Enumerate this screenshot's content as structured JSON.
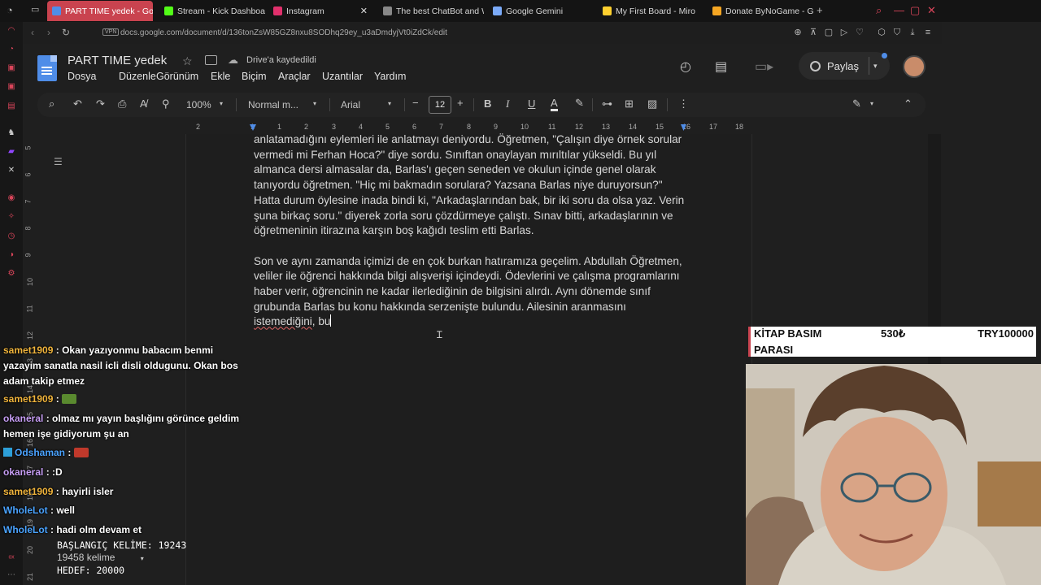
{
  "browser": {
    "tabs": [
      {
        "label": "PART TIME yedek - Goog",
        "active": true,
        "color": "#4f8de8"
      },
      {
        "label": "Stream - Kick Dashboard",
        "active": false,
        "color": "#53fc18"
      },
      {
        "label": "Instagram",
        "active": false,
        "color": "#e1306c"
      },
      {
        "label": "The best ChatBot and W",
        "active": false,
        "color": "#888888"
      },
      {
        "label": "Google Gemini",
        "active": false,
        "color": "#7baaf7"
      },
      {
        "label": "My First Board - Miro",
        "active": false,
        "color": "#ffd02f"
      },
      {
        "label": "Donate ByNoGame - Gel",
        "active": false,
        "color": "#f5a623"
      }
    ],
    "vpn": "VPN",
    "url": "docs.google.com/document/d/136tonZsW85GZ8nxu8SODhq29ey_u3aDmdyjVt0iZdCk/edit"
  },
  "docs": {
    "title": "PART TIME  yedek",
    "saved": "Drive'a kaydedildi",
    "menu": [
      "Dosya",
      "Düzenle",
      "Görünüm",
      "Ekle",
      "Biçim",
      "Araçlar",
      "Uzantılar",
      "Yardım"
    ],
    "share": "Paylaş",
    "toolbar": {
      "zoom": "100%",
      "style": "Normal m...",
      "font": "Arial",
      "size": "12"
    },
    "ruler": [
      "2",
      "1",
      "1",
      "2",
      "3",
      "4",
      "5",
      "6",
      "7",
      "8",
      "9",
      "10",
      "11",
      "12",
      "13",
      "14",
      "15",
      "16",
      "17",
      "18"
    ],
    "vruler": [
      "5",
      "6",
      "7",
      "8",
      "9",
      "10",
      "11",
      "12",
      "13",
      "14",
      "15",
      "16",
      "17",
      "18",
      "19",
      "20",
      "21"
    ],
    "para1": "anlatamadığını eylemleri ile anlatmayı deniyordu. Öğretmen, \"Çalışın diye örnek sorular vermedi mi Ferhan Hoca?\" diye sordu. Sınıftan onaylayan mırıltılar yükseldi. Bu yıl almanca dersi almasalar da, Barlas'ı geçen seneden ve okulun içinde genel olarak tanıyordu öğretmen. \"Hiç mi bakmadın sorulara? Yazsana Barlas niye duruyorsun?\" Hatta durum öylesine inada bindi ki, \"Arkadaşlarından bak, bir iki soru da olsa yaz. Verin şuna birkaç soru.\" diyerek zorla soru çözdürmeye çalıştı. Sınav bitti, arkadaşlarının ve öğretmeninin itirazına karşın boş kağıdı teslim etti Barlas.",
    "para2_a": "Son ve aynı zamanda içimizi de en çok burkan hatıramıza geçelim. Abdullah Öğretmen, veliler ile öğrenci hakkında bilgi alışverişi içindeydi. Ödevlerini ve çalışma programlarını haber verir, öğrencinin ne kadar ilerlediğinin de bilgisini alırdı. Aynı dönemde sınıf grubunda Barlas bu konu hakkında serzenişte bulundu. Ailesinin aranmasını ",
    "para2_spell": "istemediğini",
    "para2_b": ", bu"
  },
  "chat": [
    {
      "user": "samet1909",
      "text": "Okan yazıyonmu babacım benmi yazayim sanatla nasil icli disli oldugunu. Okan bos adam takip etmez",
      "color": "u"
    },
    {
      "user": "samet1909",
      "text": "",
      "emote": "#5a8a2f",
      "color": "u"
    },
    {
      "user": "okaneral",
      "text": "olmaz mı yayın başlığını görünce geldim hemen işe gidiyorum şu an",
      "color": "u2"
    },
    {
      "user": "Odshaman",
      "text": "",
      "emote": "#c0392b",
      "color": "u3",
      "badge": true
    },
    {
      "user": "okaneral",
      "text": ":D",
      "color": "u2"
    },
    {
      "user": "samet1909",
      "text": "hayirli isler",
      "color": "u"
    },
    {
      "user": "WholeLot",
      "text": "well",
      "color": "u3"
    },
    {
      "user": "WholeLot",
      "text": "hadi olm devam et",
      "color": "u3"
    }
  ],
  "counter": {
    "start": "BAŞLANGIÇ KELİME: 19243",
    "words": "19458 kelime",
    "target": "HEDEF: 20000"
  },
  "kitap": {
    "label1": "KİTAP BASIM",
    "label2": "PARASI",
    "price": "530₺",
    "goal": "TRY100000"
  }
}
